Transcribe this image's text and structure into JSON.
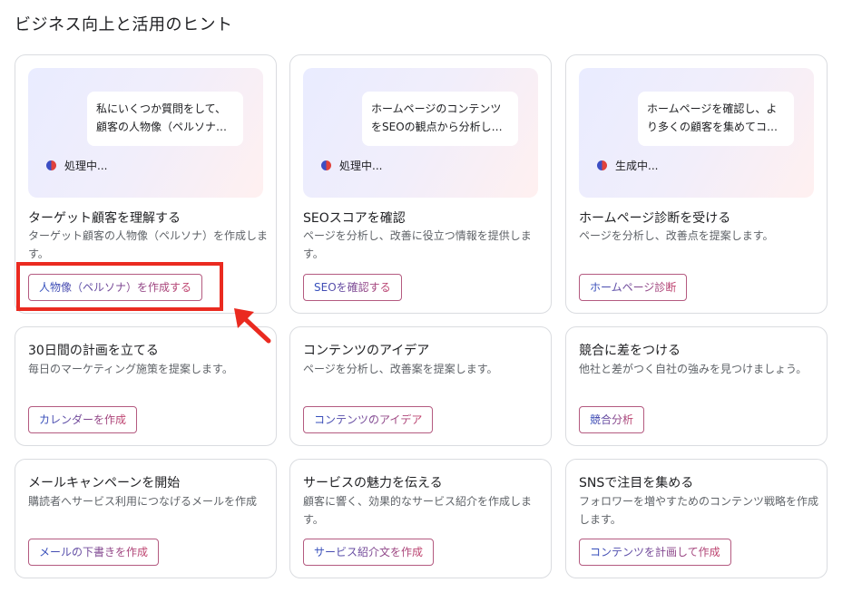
{
  "page": {
    "title": "ビジネス向上と活用のヒント"
  },
  "cards": [
    {
      "preview": {
        "bubble_line1": "私にいくつか質問をして、",
        "bubble_line2": "顧客の人物像（ペルソナ…",
        "status": "処理中..."
      },
      "title": "ターゲット顧客を理解する",
      "desc": "ターゲット顧客の人物像（ペルソナ）を作成します。",
      "action": "人物像（ペルソナ）を作成する"
    },
    {
      "preview": {
        "bubble_line1": "ホームページのコンテンツ",
        "bubble_line2": "をSEOの観点から分析し…",
        "status": "処理中..."
      },
      "title": "SEOスコアを確認",
      "desc": "ページを分析し、改善に役立つ情報を提供します。",
      "action": "SEOを確認する"
    },
    {
      "preview": {
        "bubble_line1": "ホームページを確認し、よ",
        "bubble_line2": "り多くの顧客を集めてコ…",
        "status": "生成中..."
      },
      "title": "ホームページ診断を受ける",
      "desc": "ページを分析し、改善点を提案します。",
      "action": "ホームページ診断"
    },
    {
      "title": "30日間の計画を立てる",
      "desc": "毎日のマーケティング施策を提案します。",
      "action": "カレンダーを作成"
    },
    {
      "title": "コンテンツのアイデア",
      "desc": "ページを分析し、改善案を提案します。",
      "action": "コンテンツのアイデア"
    },
    {
      "title": "競合に差をつける",
      "desc": "他社と差がつく自社の強みを見つけましょう。",
      "action": "競合分析"
    },
    {
      "title": "メールキャンペーンを開始",
      "desc": "購読者へサービス利用につなげるメールを作成",
      "action": "メールの下書きを作成"
    },
    {
      "title": "サービスの魅力を伝える",
      "desc": "顧客に響く、効果的なサービス紹介を作成します。",
      "action": "サービス紹介文を作成"
    },
    {
      "title": "SNSで注目を集める",
      "desc": "フォロワーを増やすためのコンテンツ戦略を作成します。",
      "action": "コンテンツを計画して作成"
    }
  ],
  "colors": {
    "highlight": "#ea2a20",
    "accent_start": "#2f4fbf",
    "accent_end": "#c2406a"
  }
}
